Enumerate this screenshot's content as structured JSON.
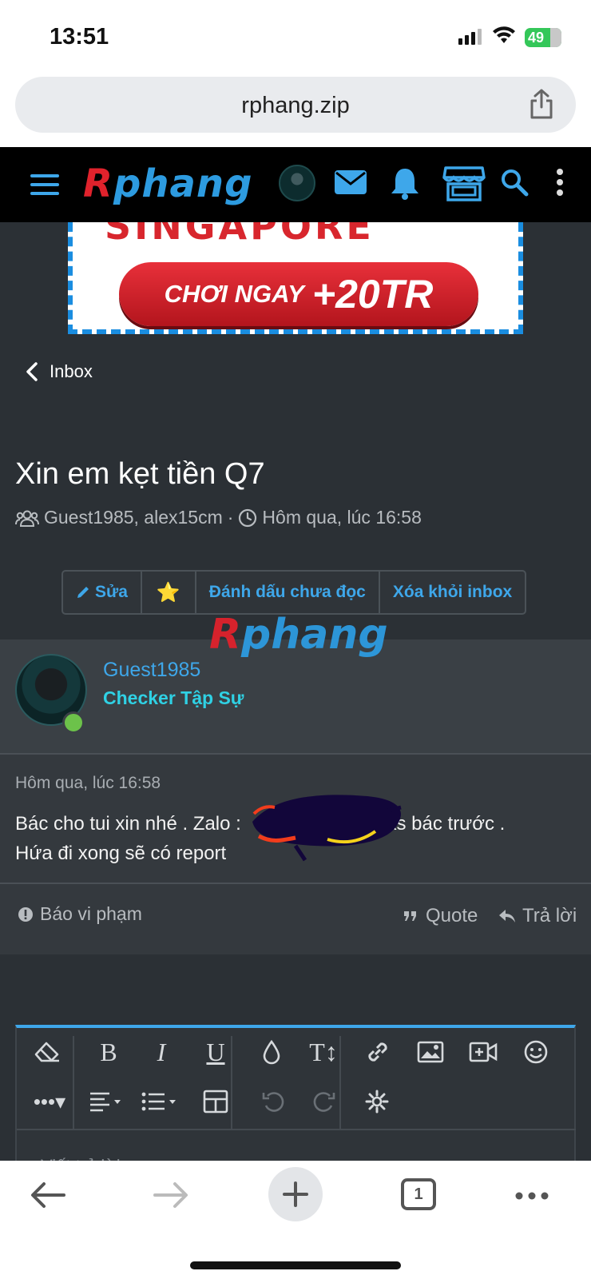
{
  "status_bar": {
    "time": "13:51",
    "battery": "49"
  },
  "browser": {
    "url": "rphang.zip",
    "tab_count": "1"
  },
  "site": {
    "logo_r": "R",
    "logo_rest": "phang"
  },
  "banner": {
    "top_text": "SINGAPORE",
    "cta_small": "CHƠI NGAY",
    "cta_big": "+20TR"
  },
  "nav": {
    "back_label": "Inbox"
  },
  "conversation": {
    "title": "Xin em kẹt tiền Q7",
    "participants": "Guest1985, alex15cm",
    "separator": "·",
    "time": "Hôm qua, lúc 16:58",
    "actions": {
      "edit": "Sửa",
      "star": "⭐",
      "mark_unread": "Đánh dấu chưa đọc",
      "remove": "Xóa khỏi inbox"
    }
  },
  "message": {
    "author": "Guest1985",
    "rank": "Checker Tập Sự",
    "date": "Hôm qua, lúc 16:58",
    "body_1": "Bác cho tui xin nhé . Zalo :",
    "body_2": "Tks bác trước .",
    "body_3": "Hứa đi xong sẽ có report",
    "report": "Báo vi phạm",
    "quote": "Quote",
    "reply": "Trả lời"
  },
  "editor": {
    "placeholder": "Viết trả lời..."
  },
  "colors": {
    "accent": "#3ea7ea",
    "rank": "#2fd1e4",
    "bg": "#2b3035",
    "logo_red": "#e0222c"
  }
}
